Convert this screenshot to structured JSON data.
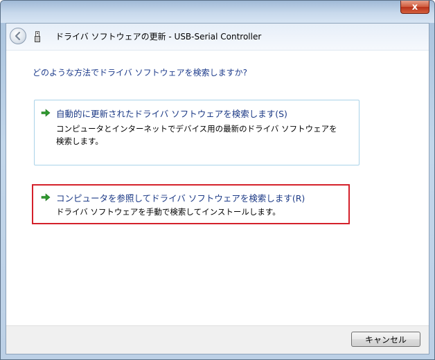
{
  "window": {
    "title": "ドライバ ソフトウェアの更新 - USB-Serial Controller",
    "close_label": "x"
  },
  "question": "どのような方法でドライバ ソフトウェアを検索しますか?",
  "options": [
    {
      "title": "自動的に更新されたドライバ ソフトウェアを検索します(S)",
      "desc_line1": "コンピュータとインターネットでデバイス用の最新のドライバ ソフトウェアを",
      "desc_line2": "検索します。"
    },
    {
      "title": "コンピュータを参照してドライバ ソフトウェアを検索します(R)",
      "desc_line1": "ドライバ ソフトウェアを手動で検索してインストールします。"
    }
  ],
  "footer": {
    "cancel_label": "キャンセル"
  },
  "colors": {
    "highlight_border": "#d4202a",
    "link_blue": "#1c3a86",
    "arrow_green": "#2e9a2e"
  },
  "icons": {
    "back": "back-arrow-icon",
    "device": "usb-device-icon",
    "option_arrow": "green-arrow-icon"
  }
}
